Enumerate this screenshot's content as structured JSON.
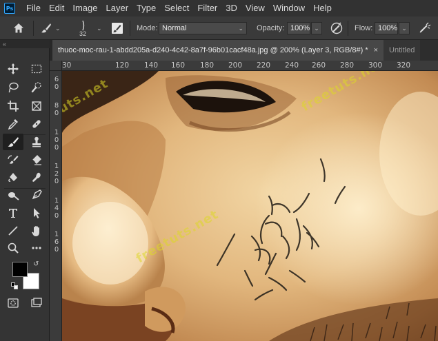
{
  "menubar": {
    "logo": "Ps",
    "items": [
      "File",
      "Edit",
      "Image",
      "Layer",
      "Type",
      "Select",
      "Filter",
      "3D",
      "View",
      "Window",
      "Help"
    ]
  },
  "options": {
    "brush_size": "32",
    "mode_label": "Mode:",
    "mode_value": "Normal",
    "opacity_label": "Opacity:",
    "opacity_value": "100%",
    "flow_label": "Flow:",
    "flow_value": "100%"
  },
  "tabs": {
    "active": "thuoc-moc-rau-1-abdd205a-d240-4c42-8a7f-96b01cacf48a.jpg @ 200% (Layer 3, RGB/8#) *",
    "close": "×",
    "second": "Untitled"
  },
  "toolbox": {
    "collapse": "«",
    "icons": [
      "move-icon",
      "marquee-icon",
      "lasso-icon",
      "quick-select-icon",
      "crop-icon",
      "frame-icon",
      "eyedropper-icon",
      "healing-icon",
      "brush-icon",
      "stamp-icon",
      "history-brush-icon",
      "eraser-icon",
      "gradient-icon",
      "blur-icon",
      "dodge-icon",
      "pen-icon",
      "type-icon",
      "path-select-icon",
      "line-icon",
      "hand-icon",
      "zoom-icon",
      "more-icon",
      "quick-mask-icon",
      "screen-mode-icon"
    ]
  },
  "rulers": {
    "horizontal": [
      "30",
      "120",
      "140",
      "160",
      "180",
      "200",
      "220",
      "240",
      "260",
      "280",
      "300",
      "320"
    ],
    "vertical": [
      "6",
      "0",
      "8",
      "0",
      "1",
      "0",
      "0",
      "1",
      "2",
      "0",
      "1",
      "4",
      "0",
      "1",
      "6",
      "0"
    ]
  },
  "watermark": "freetuts.net",
  "colors": {
    "foreground": "#000000",
    "background": "#ffffff",
    "accent": "#31a8ff"
  }
}
